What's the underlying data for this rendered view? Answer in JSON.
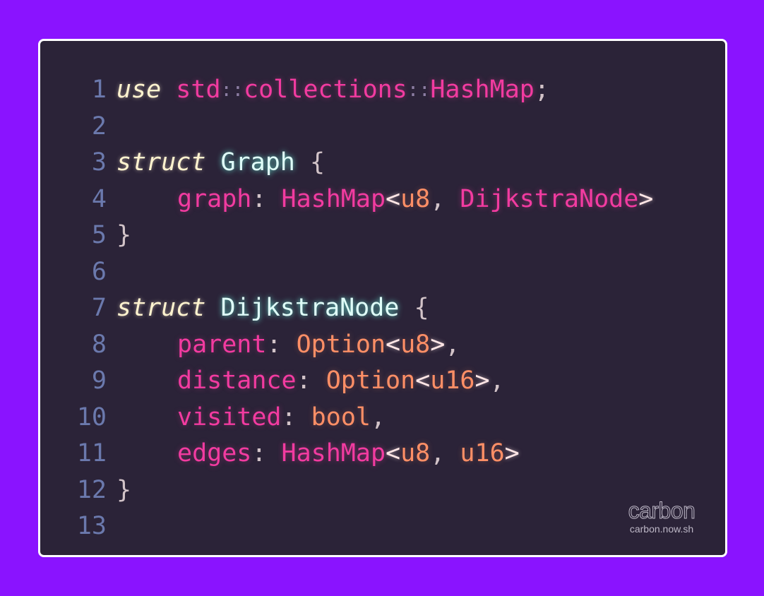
{
  "code": {
    "line_numbers": [
      "1",
      "2",
      "3",
      "4",
      "5",
      "6",
      "7",
      "8",
      "9",
      "10",
      "11",
      "12",
      "13"
    ],
    "lines": {
      "l1": {
        "use": "use",
        "std": "std",
        "sep1": "::",
        "collections": "collections",
        "sep2": "::",
        "hashmap": "HashMap",
        "semi": ";"
      },
      "l3": {
        "struct": "struct",
        "name": "Graph",
        "brace": "{"
      },
      "l4": {
        "field": "graph",
        "colon": ":",
        "type": "HashMap",
        "lt": "<",
        "arg1": "u8",
        "comma": ",",
        "arg2": "DijkstraNode",
        "gt": ">"
      },
      "l5": {
        "brace": "}"
      },
      "l7": {
        "struct": "struct",
        "name": "DijkstraNode",
        "brace": "{"
      },
      "l8": {
        "field": "parent",
        "colon": ":",
        "type": "Option",
        "lt": "<",
        "arg": "u8",
        "gt": ">",
        "comma": ","
      },
      "l9": {
        "field": "distance",
        "colon": ":",
        "type": "Option",
        "lt": "<",
        "arg": "u16",
        "gt": ">",
        "comma": ","
      },
      "l10": {
        "field": "visited",
        "colon": ":",
        "type": "bool",
        "comma": ","
      },
      "l11": {
        "field": "edges",
        "colon": ":",
        "type": "HashMap",
        "lt": "<",
        "arg1": "u8",
        "comma": ",",
        "arg2": "u16",
        "gt": ">"
      },
      "l12": {
        "brace": "}"
      }
    }
  },
  "watermark": {
    "logo": "carbon",
    "url": "carbon.now.sh"
  },
  "colors": {
    "background": "#8a13ff",
    "editor_background": "#2b2338",
    "keyword": "#fff3cf",
    "type": "#f23ba0",
    "struct_name": "#dffdf8",
    "primitive": "#ff8f66",
    "line_number": "#6b79ad"
  }
}
